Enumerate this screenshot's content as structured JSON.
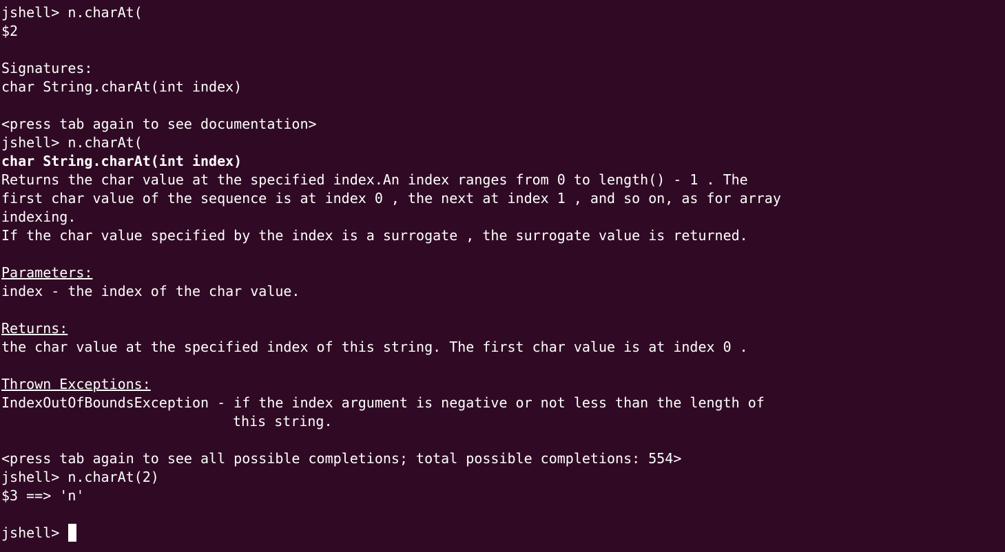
{
  "terminal": {
    "lines": {
      "l1": "jshell> n.charAt(",
      "l2": "$2",
      "l4": "Signatures:",
      "l5": "char String.charAt(int index)",
      "l7": "<press tab again to see documentation>",
      "l8": "jshell> n.charAt(",
      "l9": "char String.charAt(int index)",
      "l10": "Returns the char value at the specified index.An index ranges from 0 to length() - 1 . The",
      "l11": "first char value of the sequence is at index 0 , the next at index 1 , and so on, as for array",
      "l12": "indexing.",
      "l13": "If the char value specified by the index is a surrogate , the surrogate value is returned.",
      "l15": "Parameters:",
      "l16": "index - the index of the char value.",
      "l18": "Returns:",
      "l19": "the char value at the specified index of this string. The first char value is at index 0 .",
      "l21": "Thrown Exceptions:",
      "l22": "IndexOutOfBoundsException - if the index argument is negative or not less than the length of",
      "l23": "this string.",
      "l25": "<press tab again to see all possible completions; total possible completions: 554>",
      "l26": "jshell> n.charAt(2)",
      "l27": "$3 ==> 'n'",
      "l29": "jshell> "
    },
    "colors": {
      "background": "#300a24",
      "foreground": "#ffffff"
    }
  }
}
